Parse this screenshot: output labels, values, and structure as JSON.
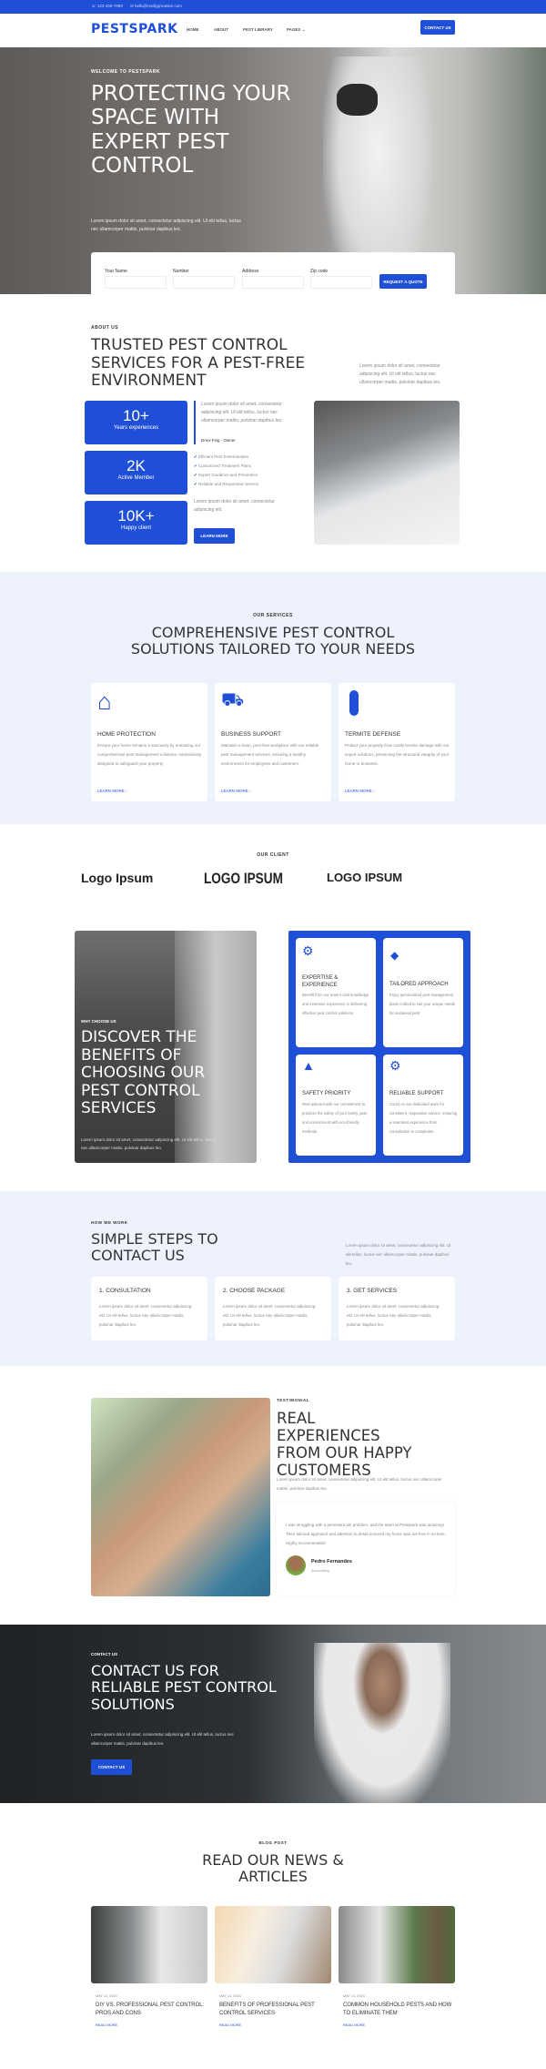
{
  "topbar": {
    "phone": "123-456-7890",
    "email": "hello@reallygreatsite.com"
  },
  "nav": {
    "logo": "PESTSPARK",
    "items": [
      "HOME",
      "ABOUT",
      "PEST LIBRARY",
      "PAGES"
    ],
    "cta": "CONTACT US"
  },
  "hero": {
    "eyebrow": "WELCOME TO PESTSPARK",
    "title": "PROTECTING YOUR SPACE WITH EXPERT PEST CONTROL",
    "text": "Lorem ipsum dolor sit amet, consectetur adipiscing elit. Ut elit tellus, luctus nec ullamcorper mattis, pulvinar dapibus leo.",
    "form": {
      "fields": [
        "Your Name",
        "Number",
        "Address",
        "Zip code"
      ],
      "button": "REQUEST A QUOTE"
    }
  },
  "about": {
    "eyebrow": "ABOUT US",
    "title": "TRUSTED PEST CONTROL SERVICES FOR A PEST-FREE ENVIRONMENT",
    "side_text": "Lorem ipsum dolor sit amet, consectetur adipiscing elit. Ut elit tellus, luctus nec ullamcorper mattis, pulvinar dapibus leo.",
    "stats": [
      {
        "value": "10+",
        "label": "Years experiences"
      },
      {
        "value": "2K",
        "label": "Active Member"
      },
      {
        "value": "10K+",
        "label": "Happy client"
      }
    ],
    "quote": "Lorem ipsum dolor sit amet, consectetur adipiscing elit. Ut elit tellus, luctus nec ullamcorper mattis, pulvinar dapibus leo.",
    "author": "Drew Feig - Owner",
    "checks": [
      "Efficient Pest Extermination",
      "Customized Treatment Plans",
      "Expert Guidance and Prevention",
      "Reliable and Responsive Service"
    ],
    "text2": "Lorem ipsum dolor sit amet, consectetur adipiscing elit.",
    "button": "LEARN MORE"
  },
  "services": {
    "eyebrow": "OUR SERVICES",
    "title": "COMPREHENSIVE PEST CONTROL SOLUTIONS TAILORED TO YOUR NEEDS",
    "items": [
      {
        "icon": "house-search-icon",
        "title": "HOME PROTECTION",
        "text": "Ensure your home remains a sanctuary by entrusting our comprehensive pest management solutions, meticulously designed to safeguard your property",
        "link": "LEARN MORE"
      },
      {
        "icon": "van-icon",
        "title": "BUSINESS SUPPORT",
        "text": "Maintain a clean, pest-free workplace with our reliable pest management services, ensuring a healthy environment for employees and customers.",
        "link": "LEARN MORE"
      },
      {
        "icon": "termite-icon",
        "title": "TERMITE DEFENSE",
        "text": "Protect your property from costly termite damage with our expert solutions, preserving the structural integrity of your home or business.",
        "link": "LEARN MORE"
      }
    ]
  },
  "clients": {
    "eyebrow": "OUR CLIENT",
    "logos": [
      "Logo Ipsum",
      "LOGO IPSUM",
      "LOGO IPSUM"
    ]
  },
  "why": {
    "eyebrow": "WHY CHOOSE US",
    "title": "DISCOVER THE BENEFITS OF CHOOSING OUR PEST CONTROL SERVICES",
    "text": "Lorem ipsum dolor sit amet, consectetur adipiscing elit. Ut elit tellus, luctus nec ullamcorper mattis, pulvinar dapibus leo.",
    "items": [
      {
        "icon": "badge-icon",
        "title": "EXPERTISE & EXPERIENCE",
        "text": "Benefit from our team's vast knowledge and extensive experience in delivering effective pest control solutions."
      },
      {
        "icon": "diamond-icon",
        "title": "TAILORED APPROACH",
        "text": "Enjoy personalized pest management plans crafted to suit your unique needs for sustained pest"
      },
      {
        "icon": "safety-hand-icon",
        "title": "SAFETY PRIORITY",
        "text": "Rest assured with our commitment to prioritize the safety of your family, pets, and environment with eco-friendly methods."
      },
      {
        "icon": "gears-icon",
        "title": "RELIABLE SUPPORT",
        "text": "Count on our dedicated team for consistent, responsive service, ensuring a seamless experience from consultation to completion."
      }
    ]
  },
  "steps": {
    "eyebrow": "HOW WE WORK",
    "title": "SIMPLE STEPS TO CONTACT US",
    "side_text": "Lorem ipsum dolor sit amet, consectetur adipiscing elit. Ut elit tellus, luctus nec ullamcorper mattis, pulvinar dapibus leo.",
    "items": [
      {
        "title": "1. CONSULTATION",
        "text": "Lorem ipsum dolor sit amet, consectetur adipiscing elit. Ut elit tellus, luctus nec ullamcorper mattis, pulvinar dapibus leo."
      },
      {
        "title": "2. CHOOSE PACKAGE",
        "text": "Lorem ipsum dolor sit amet, consectetur adipiscing elit. Ut elit tellus, luctus nec ullamcorper mattis, pulvinar dapibus leo."
      },
      {
        "title": "3. GET SERVICES",
        "text": "Lorem ipsum dolor sit amet, consectetur adipiscing elit. Ut elit tellus, luctus nec ullamcorper mattis, pulvinar dapibus leo."
      }
    ]
  },
  "testimonial": {
    "eyebrow": "TESTIMONIAL",
    "title": "REAL EXPERIENCES FROM OUR HAPPY CUSTOMERS",
    "text": "Lorem ipsum dolor sit amet, consectetur adipiscing elit. Ut elit tellus, luctus nec ullamcorper mattis, pulvinar dapibus leo.",
    "quote": "I was struggling with a persistent ant problem, and the team at Pestspark was amazing! Their tailored approach and attention to detail ensured my home was ant-free in no time. Highly recommended!",
    "name": "Pedro Fernandes",
    "role": "Accounting"
  },
  "contact": {
    "eyebrow": "CONTACT US",
    "title": "CONTACT US FOR RELIABLE PEST CONTROL SOLUTIONS",
    "text": "Lorem ipsum dolor sit amet, consectetur adipiscing elit. Ut elit tellus, luctus nec ullamcorper mattis, pulvinar dapibus leo.",
    "button": "CONTACT US"
  },
  "blog": {
    "eyebrow": "BLOG POST",
    "title": "READ OUR NEWS & ARTICLES",
    "posts": [
      {
        "date": "MAY 14, 2024",
        "title": "DIY VS. PROFESSIONAL PEST CONTROL: PROS AND CONS",
        "link": "READ MORE"
      },
      {
        "date": "MAY 14, 2024",
        "title": "BENEFITS OF PROFESSIONAL PEST CONTROL SERVICES",
        "link": "READ MORE"
      },
      {
        "date": "MAY 14, 2024",
        "title": "COMMON HOUSEHOLD PESTS AND HOW TO ELIMINATE THEM",
        "link": "READ MORE"
      }
    ]
  },
  "colors": {
    "primary": "#1f4fd6",
    "light_bg": "#eef2fd",
    "dark_text": "#333333"
  }
}
